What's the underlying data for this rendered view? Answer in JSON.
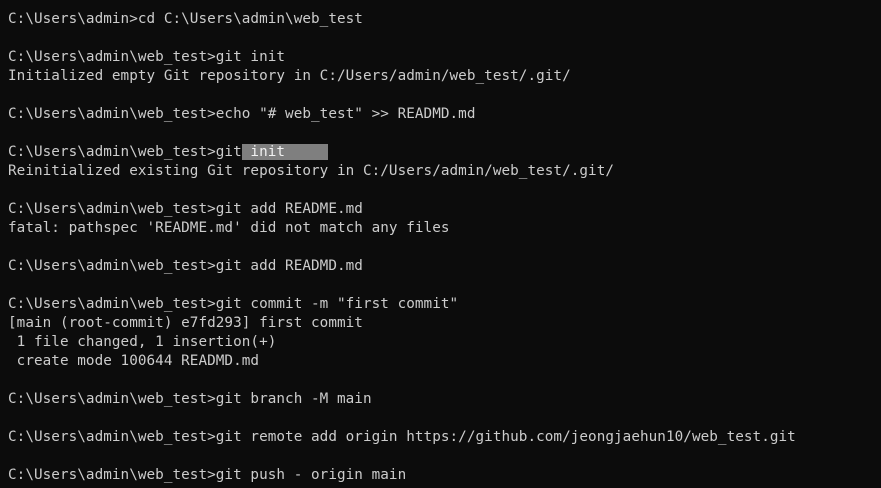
{
  "terminal": {
    "lines": [
      "C:\\Users\\admin>cd C:\\Users\\admin\\web_test",
      "",
      "C:\\Users\\admin\\web_test>git init",
      "Initialized empty Git repository in C:/Users/admin/web_test/.git/",
      "",
      "C:\\Users\\admin\\web_test>echo \"# web_test\" >> READMD.md",
      "",
      "C:\\Users\\admin\\web_test>git",
      "Reinitialized existing Git repository in C:/Users/admin/web_test/.git/",
      "",
      "C:\\Users\\admin\\web_test>git add README.md",
      "fatal: pathspec 'README.md' did not match any files",
      "",
      "C:\\Users\\admin\\web_test>git add READMD.md",
      "",
      "C:\\Users\\admin\\web_test>git commit -m \"first commit\"",
      "[main (root-commit) e7fd293] first commit",
      " 1 file changed, 1 insertion(+)",
      " create mode 100644 READMD.md",
      "",
      "C:\\Users\\admin\\web_test>git branch -M main",
      "",
      "C:\\Users\\admin\\web_test>git remote add origin https://github.com/jeongjaehun10/web_test.git",
      "",
      "C:\\Users\\admin\\web_test>git push - origin main"
    ],
    "selection_text": " init     "
  }
}
